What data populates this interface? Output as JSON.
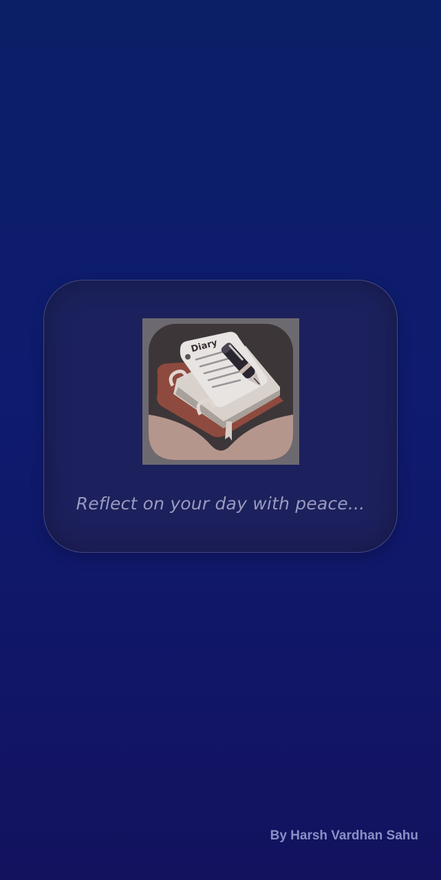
{
  "splash": {
    "logo_icon": "diary-book-pen-icon",
    "logo_text": "Diary",
    "tagline": "Reflect on your day with peace...",
    "credit": "By Harsh Vardhan Sahu"
  },
  "colors": {
    "background_top": "#0b1f66",
    "background_bottom": "#13125f",
    "tagline": "#9a9ac0",
    "credit": "#8c8fc4"
  }
}
